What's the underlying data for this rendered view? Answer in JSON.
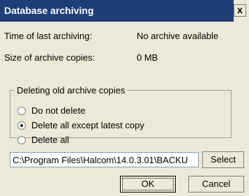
{
  "window": {
    "title": "Database archiving",
    "close_label": "x"
  },
  "info": {
    "last_archiving_label": "Time of last archiving:",
    "last_archiving_value": "No archive available",
    "size_label": "Size of archive copies:",
    "size_value": "0 MB"
  },
  "deleting_group": {
    "legend": "Deleting old archive copies",
    "options": [
      {
        "label": "Do not delete",
        "checked": false
      },
      {
        "label": "Delete all except latest copy",
        "checked": true
      },
      {
        "label": "Delete all",
        "checked": false
      }
    ]
  },
  "path": {
    "value": "C:\\Program Files\\Halcom\\14.0.3.01\\BACKU"
  },
  "buttons": {
    "select_label": "Select",
    "ok_label": "OK",
    "cancel_label": "Cancel"
  }
}
